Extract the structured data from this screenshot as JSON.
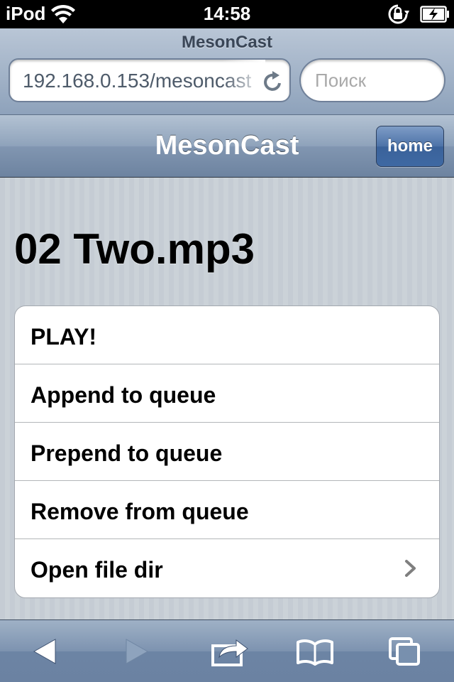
{
  "status_bar": {
    "carrier": "iPod",
    "time": "14:58"
  },
  "browser": {
    "title": "MesonCast",
    "url": "192.168.0.153/mesoncast",
    "search_placeholder": "Поиск"
  },
  "page": {
    "header_title": "MesonCast",
    "home_label": "home",
    "file_title": "02 Two.mp3",
    "menu": [
      {
        "label": "PLAY!"
      },
      {
        "label": "Append to queue"
      },
      {
        "label": "Prepend to queue"
      },
      {
        "label": "Remove from queue"
      },
      {
        "label": "Open file dir"
      }
    ]
  },
  "icons": {
    "wifi": "wifi-icon",
    "lock": "orientation-lock-icon",
    "battery": "battery-charging-icon",
    "reload": "reload-icon",
    "back": "back-arrow-icon",
    "forward": "forward-arrow-icon",
    "share": "share-icon",
    "bookmarks": "bookmarks-icon",
    "tabs": "tabs-icon"
  },
  "colors": {
    "toolbar": "#8196b1",
    "home_button": "#4d73a8",
    "background": "#c5ccd4"
  }
}
